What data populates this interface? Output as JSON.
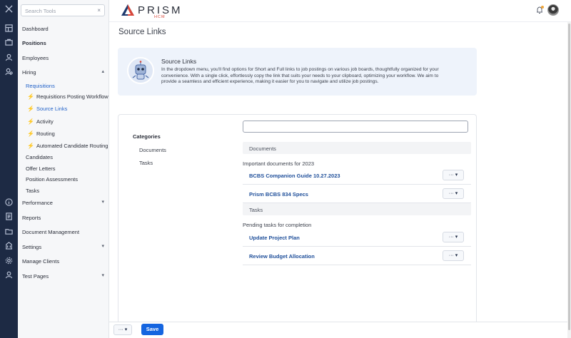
{
  "search": {
    "placeholder": "Search Tools",
    "clear_glyph": "×"
  },
  "rail": {
    "icons": [
      "close-icon",
      "dashboard-icon",
      "briefcase-icon",
      "person-icon",
      "hiring-icon",
      "info-icon",
      "report-icon",
      "folder-icon",
      "building-icon",
      "settings-icon",
      "user-icon"
    ]
  },
  "sidebar": {
    "items": [
      {
        "label": "Dashboard"
      },
      {
        "label": "Positions"
      },
      {
        "label": "Employees"
      },
      {
        "label": "Hiring"
      },
      {
        "label": "Requisitions"
      },
      {
        "label": "Requisitions Posting Workflow"
      },
      {
        "label": "Source Links"
      },
      {
        "label": "Activity"
      },
      {
        "label": "Routing"
      },
      {
        "label": "Automated Candidate Routing"
      },
      {
        "label": "Candidates"
      },
      {
        "label": "Offer Letters"
      },
      {
        "label": "Position Assessments"
      },
      {
        "label": "Tasks"
      },
      {
        "label": "Performance"
      },
      {
        "label": "Reports"
      },
      {
        "label": "Document Management"
      },
      {
        "label": "Settings"
      },
      {
        "label": "Manage Clients"
      },
      {
        "label": "Test Pages"
      }
    ]
  },
  "header": {
    "brand": "PRISM",
    "brand_sub": "HCM"
  },
  "page": {
    "title": "Source Links",
    "info_title": "Source Links",
    "info_text": "In the dropdown menu, you'll find options for Short and Full links to job postings on various job boards, thoughtfully organized for your convenience. With a single click, effortlessly copy the link that suits your needs to your clipboard, optimizing your workflow. We aim to provide a seamless and efficient experience, making it easier for you to navigate and utilize job postings."
  },
  "panel": {
    "categories_heading": "Categories",
    "categories": [
      "Documents",
      "Tasks"
    ],
    "sections": [
      {
        "title": "Documents",
        "subtitle": "Important documents for 2023",
        "rows": [
          "BCBS Companion Guide 10.27.2023",
          "Prism BCBS 834 Specs"
        ]
      },
      {
        "title": "Tasks",
        "subtitle": "Pending tasks for completion",
        "rows": [
          "Update Project Plan",
          "Review Budget Allocation"
        ]
      }
    ],
    "more_label": "··· ▾"
  },
  "footer": {
    "more_label": "··· ▾",
    "save_label": "Save"
  },
  "colors": {
    "rail": "#1d2a44",
    "accent": "#1565e0",
    "link": "#1f4f9a",
    "active": "#2564c9"
  }
}
